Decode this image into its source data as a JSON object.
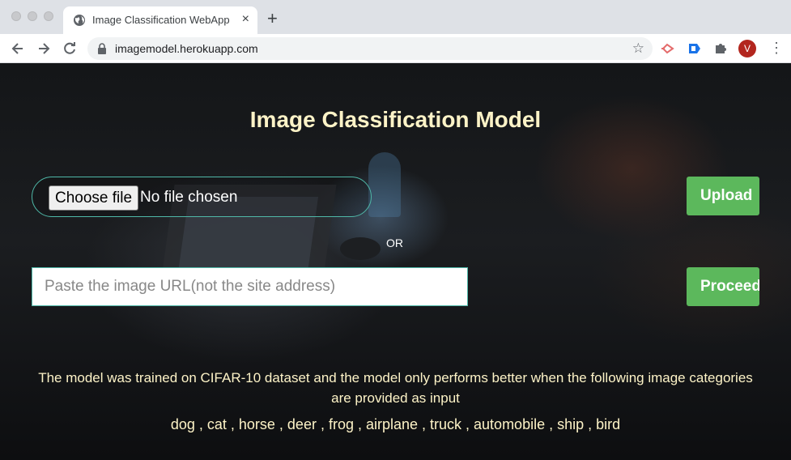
{
  "browser": {
    "tab_title": "Image Classification WebApp",
    "tab_close": "×",
    "new_tab": "+",
    "url": "imagemodel.herokuapp.com",
    "avatar_letter": "V",
    "star": "☆",
    "menu": "⋮"
  },
  "icons": {
    "tab": "globe-icon",
    "back": "back-arrow-icon",
    "forward": "forward-arrow-icon",
    "reload": "reload-icon",
    "lock": "lock-icon",
    "bookmark": "star-icon",
    "extensions": [
      "red-extension-icon",
      "blue-extension-icon",
      "puzzle-icon"
    ]
  },
  "colors": {
    "accent_green": "#5cb85c",
    "title_text": "#fdf3c7",
    "input_border": "#4fb8a8"
  },
  "main": {
    "title": "Image Classification Model",
    "file_input": {
      "button_label": "Choose file",
      "status": "No file chosen"
    },
    "upload_label": "Upload",
    "or_label": "OR",
    "url_placeholder": "Paste the image URL(not the site address)",
    "url_value": "",
    "proceed_label": "Proceed",
    "info_text": "The model was trained on CIFAR-10 dataset and the model only performs better when the following image categories are provided as input",
    "categories_text": "dog , cat , horse , deer , frog , airplane , truck , automobile , ship , bird"
  }
}
